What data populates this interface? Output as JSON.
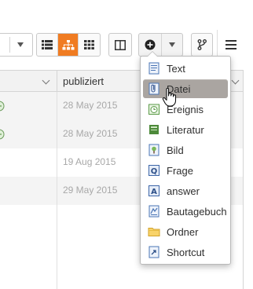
{
  "toolbar": {
    "view_buttons": [
      {
        "icon": "list-icon",
        "active": false
      },
      {
        "icon": "hierarchy-icon",
        "active": true
      },
      {
        "icon": "grid-icon",
        "active": false
      }
    ],
    "accent_color": "#f07c22",
    "add_button_icon": "plus-circle-icon",
    "panel_toggle_icon": "columns-icon",
    "branch_icon": "branch-icon",
    "menu_icon": "hamburger-icon"
  },
  "table": {
    "column_header": "publiziert",
    "rows": [
      {
        "published": "28 May 2015"
      },
      {
        "published": "28 May 2015"
      },
      {
        "published": "19 Aug 2015"
      },
      {
        "published": "29 May 2015"
      }
    ]
  },
  "add_menu": {
    "items": [
      {
        "label": "Text",
        "icon": "text-document-icon"
      },
      {
        "label": "Datei",
        "icon": "file-paperclip-icon",
        "hover": true
      },
      {
        "label": "Ereignis",
        "icon": "event-clock-icon"
      },
      {
        "label": "Literatur",
        "icon": "book-icon"
      },
      {
        "label": "Bild",
        "icon": "image-icon"
      },
      {
        "label": "Frage",
        "icon": "question-icon"
      },
      {
        "label": "answer",
        "icon": "answer-icon"
      },
      {
        "label": "Bautagebuch",
        "icon": "construction-diary-icon"
      },
      {
        "label": "Ordner",
        "icon": "folder-icon"
      },
      {
        "label": "Shortcut",
        "icon": "shortcut-icon"
      }
    ]
  }
}
